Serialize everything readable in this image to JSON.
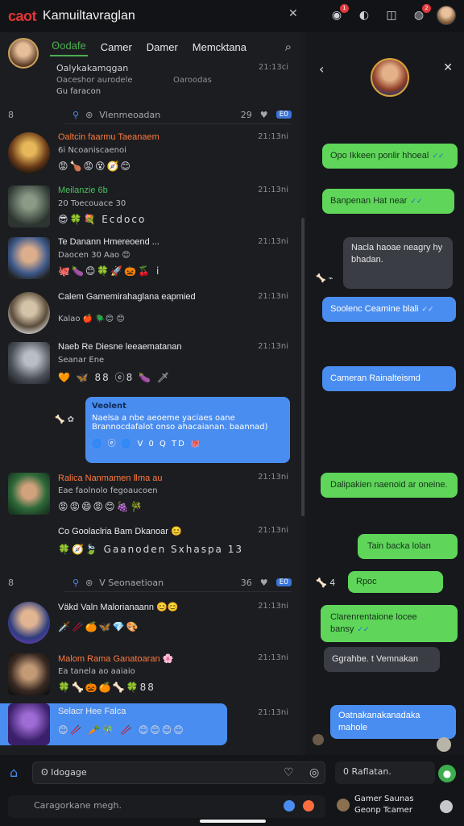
{
  "app": {
    "brand": "caot",
    "title": "Kamuiltaνraglan"
  },
  "tabs": [
    "Ꙩodafe",
    "Camer",
    "Damer",
    "Memcktana"
  ],
  "pinned": {
    "title": "Oalykakamqgan",
    "line2": "Oaceshor aurodele",
    "line2_right": "Oaroodas",
    "line3": "Gu faracon",
    "time": "21:13ci"
  },
  "section1": {
    "num": "8",
    "label": "Vlenmeoadan",
    "count": "29"
  },
  "section2": {
    "num": "8",
    "label": "V  Seonaetioan",
    "count": "36"
  },
  "chats": [
    {
      "title": "Oaltcin faarmu  Taeanaem",
      "sub": "6i Ncoaniscaenoi",
      "time": "21:13ni",
      "emoji": "😡🍗😡😵🧭😊"
    },
    {
      "title": "Meilanzie 6b",
      "sub": "20 Toecouace 30",
      "time": "21:13ni",
      "emoji": "😎🍀💐 Ecdoco"
    },
    {
      "title": "Te Danann Hmereoend ...",
      "sub": "Daocen 30 Aao 😊",
      "time": "21:13ni",
      "emoji": "🐙🍆😊🍀🚀🎃🍒 i"
    },
    {
      "title": "Calem Gamemirahaglana eapmied",
      "sub": "Kalao 🍎 🪲😊 😊",
      "time": "21:13ni",
      "emoji": ""
    },
    {
      "title": "Naeb Re Diesne leeaematanan",
      "sub": "Seanar Ene",
      "time": "21:13ni",
      "emoji": "🧡 🦋 88 ⓔ8 🍆 🗡"
    },
    {
      "title": "Ralica Nanmamen Ⅱma au",
      "sub": "Eae faolnolo fegoaucoen",
      "time": "21:13ni",
      "emoji": "😡😡😄😡😊🍇🎋"
    },
    {
      "title": "Co Goolaclria Bam Dkanoar 😊",
      "sub": "",
      "time": "21:13ni",
      "emoji": "🍀🧭🍃 Gaanoden Sxhaspa 13"
    },
    {
      "title": "Väkd Valn Malorianaann 😊😊",
      "sub": "",
      "time": "21:13ni",
      "emoji": "🗡️🥢🍊🦋💎🎨"
    },
    {
      "title": "Malom Rama Ganatoaran 🌸",
      "sub": "Ea tanela ao aaiaio",
      "time": "21:13ni",
      "emoji": "🍀🦴🎃🍊🦴🍀88"
    },
    {
      "title": "Selacr Hee Falca",
      "sub": "",
      "time": "21:13ni",
      "emoji": "😊🥢 🥕🎋 🥢 😊😊😊😊"
    }
  ],
  "left_bubble": {
    "head": "Veolent",
    "line1": "Naelsa a nbe aeoeme yaciaes oane",
    "line2": "Brannocdafalot onso ahacaianan. baannad)",
    "footer": "🌀 ⓔ 🌀 V 0 Q TD  🐙"
  },
  "messages": [
    {
      "side": "right",
      "type": "g",
      "text": "Opo Ikkeen ponlir hhoeal",
      "tick": "✓✓"
    },
    {
      "side": "right",
      "type": "g",
      "text": "Banpenan Hat near",
      "tick": "✓✓"
    },
    {
      "side": "left",
      "type": "d",
      "text": "Nacla haoae neagry hy bhadan.",
      "tick": ""
    },
    {
      "side": "right",
      "type": "b",
      "text": "Soolenc Ceamine blali",
      "tick": "✓✓"
    },
    {
      "side": "right",
      "type": "b",
      "text": "Cameran Rainalteismd",
      "tick": ""
    },
    {
      "side": "right",
      "type": "g",
      "text": "Dalipakien naenoid ar oneine.",
      "tick": ""
    },
    {
      "side": "right",
      "type": "g",
      "text": "Tain backa lolan",
      "tick": ""
    },
    {
      "side": "right",
      "type": "g",
      "text": "Rpoc",
      "tick": ""
    },
    {
      "side": "right",
      "type": "g",
      "text": "Clarenrentaione locee bansy",
      "tick": "✓✓"
    },
    {
      "side": "left",
      "type": "d",
      "text": "Ggrahbe. t Vemnakan",
      "tick": ""
    },
    {
      "side": "right",
      "type": "b",
      "text": "Oatnakanakanadaka mahole",
      "tick": ""
    }
  ],
  "bottom": {
    "input_placeholder": "Ꙩ Idogage",
    "right_input": "0  Raflatan.",
    "search_placeholder": "Caragorkane megh.",
    "right_caption1": "Gamer Saunas",
    "right_caption2": "Geonp Tcamer"
  }
}
